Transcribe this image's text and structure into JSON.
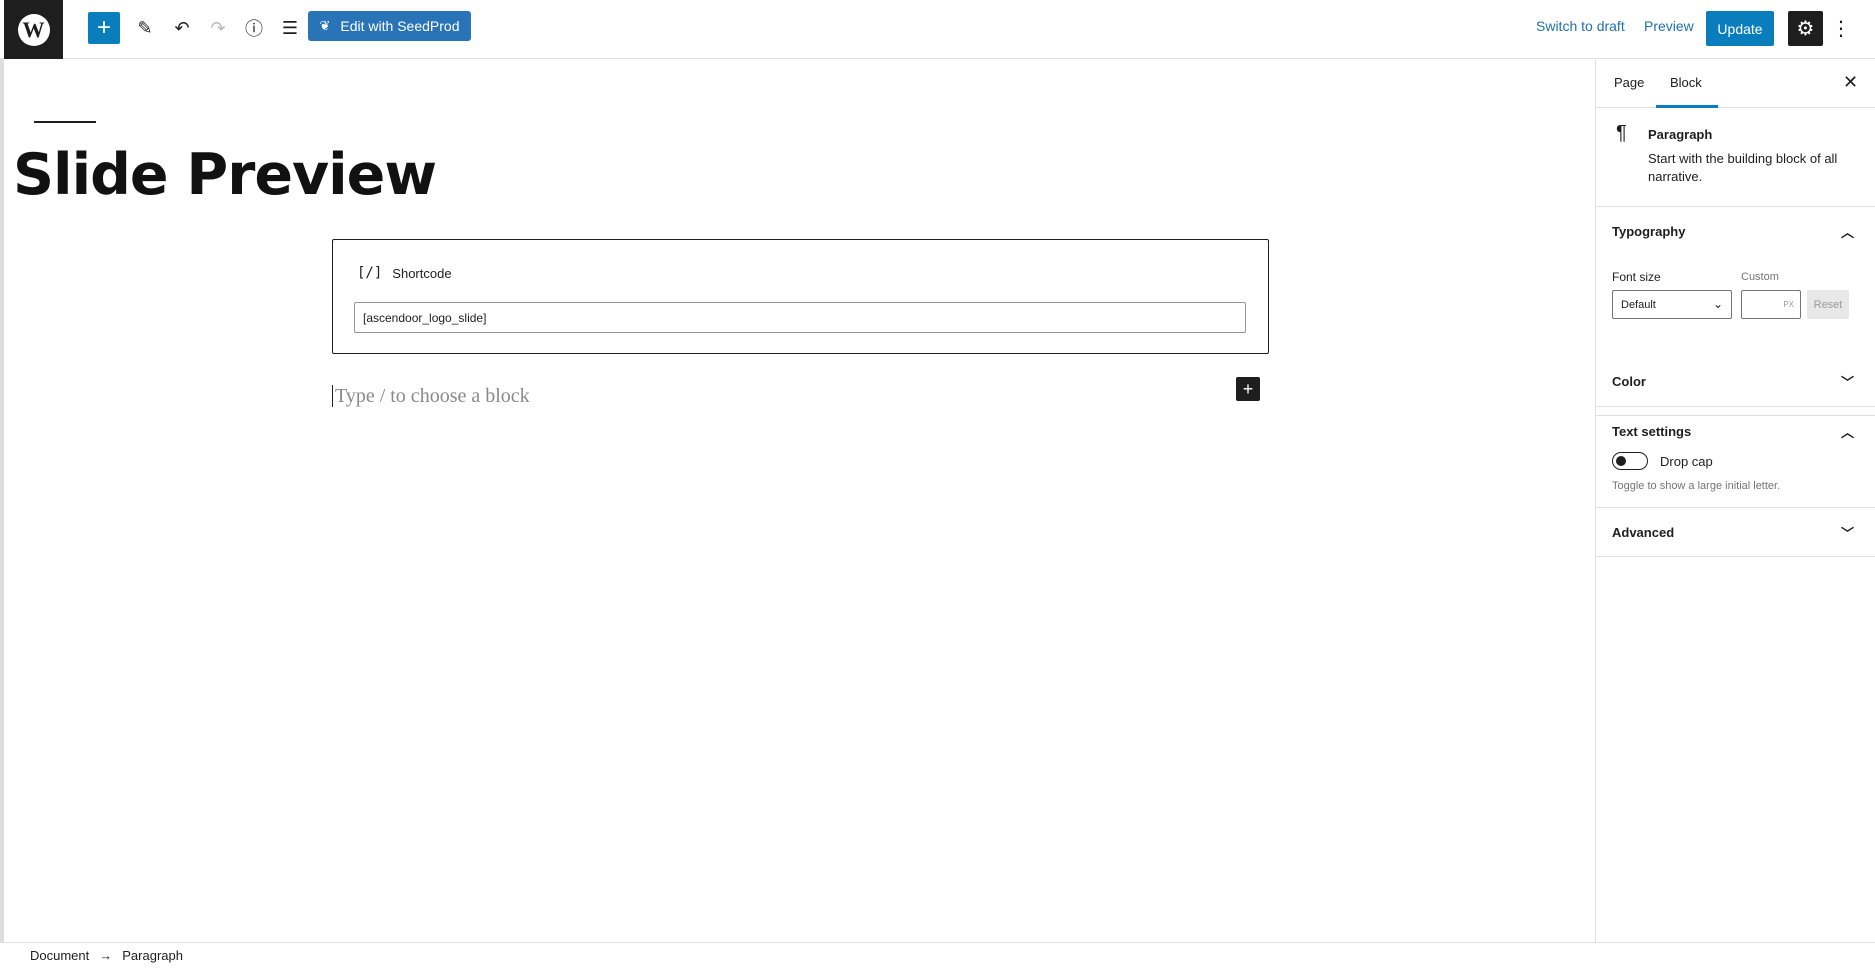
{
  "toolbar": {
    "logo": "W",
    "inserter_icon": "+",
    "tools_icon": "✎",
    "undo_icon": "↶",
    "redo_icon": "↷",
    "details_icon": "ⓘ",
    "outline_icon": "☰",
    "seedprod_label": "Edit with SeedProd",
    "switch_draft_label": "Switch to draft",
    "preview_label": "Preview",
    "update_label": "Update",
    "settings_icon": "⚙",
    "more_icon": "⋮",
    "accent": "#0a7ebd"
  },
  "editor": {
    "title": "Slide Preview",
    "shortcode_icon": "[/]",
    "shortcode_label": "Shortcode",
    "shortcode_value": "[ascendoor_logo_slide]",
    "paragraph_placeholder": "Type / to choose a block",
    "block_inserter_icon": "+"
  },
  "sidebar": {
    "tab_page": "Page",
    "tab_block": "Block",
    "close_icon": "✕",
    "block_icon": "¶",
    "block_name": "Paragraph",
    "block_desc": "Start with the building block of all narrative.",
    "typography_label": "Typography",
    "font_size_label": "Font size",
    "custom_label": "Custom",
    "font_size_value": "Default",
    "select_caret": "⌄",
    "custom_unit": "PX",
    "reset_label": "Reset",
    "color_label": "Color",
    "text_settings_label": "Text settings",
    "drop_cap_label": "Drop cap",
    "drop_cap_help": "Toggle to show a large initial letter.",
    "advanced_label": "Advanced",
    "chevron_up": "︿",
    "chevron_down": "﹀"
  },
  "footer": {
    "crumb_document": "Document",
    "crumb_sep": "→",
    "crumb_paragraph": "Paragraph"
  }
}
